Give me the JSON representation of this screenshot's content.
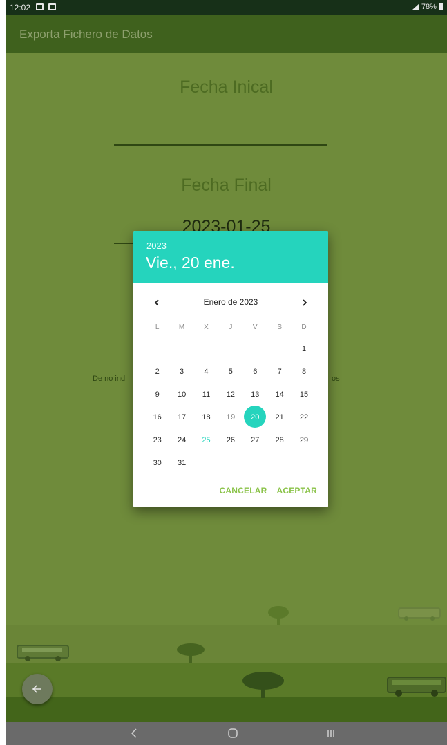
{
  "status_bar": {
    "time": "12:02",
    "battery": "78%"
  },
  "app_bar": {
    "title": "Exporta Fichero de Datos"
  },
  "form": {
    "start_label": "Fecha Inical",
    "start_value": "",
    "end_label": "Fecha Final",
    "end_value": "2023-01-25",
    "note_left": "De no ind",
    "note_right": "os"
  },
  "date_picker": {
    "year": "2023",
    "selected_display": "Vie., 20 ene.",
    "month_title": "Enero de 2023",
    "weekdays": [
      "L",
      "M",
      "X",
      "J",
      "V",
      "S",
      "D"
    ],
    "weeks": [
      [
        "",
        "",
        "",
        "",
        "",
        "",
        "1"
      ],
      [
        "2",
        "3",
        "4",
        "5",
        "6",
        "7",
        "8"
      ],
      [
        "9",
        "10",
        "11",
        "12",
        "13",
        "14",
        "15"
      ],
      [
        "16",
        "17",
        "18",
        "19",
        "20",
        "21",
        "22"
      ],
      [
        "23",
        "24",
        "25",
        "26",
        "27",
        "28",
        "29"
      ],
      [
        "30",
        "31",
        "",
        "",
        "",
        "",
        ""
      ]
    ],
    "selected_day": "20",
    "today_day": "25",
    "cancel_label": "CANCELAR",
    "accept_label": "ACEPTAR",
    "accent_color": "#25d4bd",
    "action_color": "#8bc34a"
  },
  "icons": {
    "fab": "arrow-left-icon",
    "prev_month": "chevron-left-icon",
    "next_month": "chevron-right-icon",
    "nav_back": "nav-back-icon",
    "nav_home": "nav-home-icon",
    "nav_recents": "nav-recents-icon"
  }
}
